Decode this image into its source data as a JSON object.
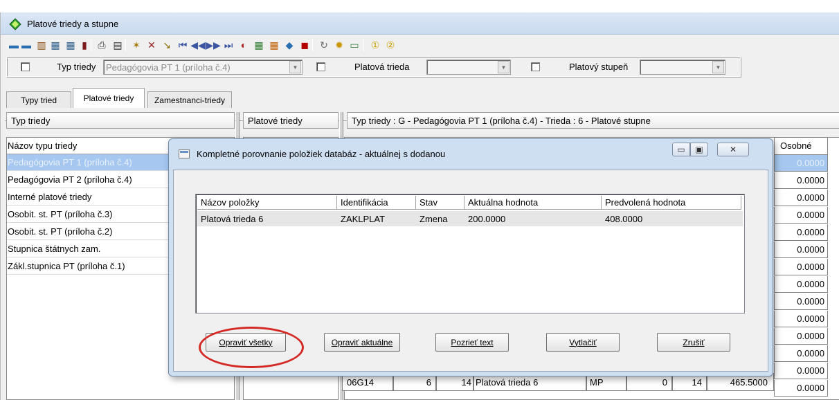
{
  "window": {
    "title": "Platové triedy a stupne"
  },
  "toolbar": {
    "icons": [
      "new-record-icon",
      "copy-record-icon",
      "columns-icon",
      "table-icon",
      "table-2-icon",
      "delete-icon",
      "print-icon",
      "print-preview-icon",
      "filter-icon",
      "clear-filter-icon",
      "sort-icon",
      "first-record-icon",
      "previous-record-icon",
      "next-record-icon",
      "last-record-icon",
      "refresh-icon",
      "calendar-icon",
      "import-icon",
      "export-icon",
      "copy-icon",
      "sync-icon",
      "lightbulb-icon",
      "window-icon",
      "info-1-icon",
      "info-2-icon"
    ],
    "glyphs": [
      "▬",
      "▬",
      "▥",
      "▦",
      "▦",
      "▮",
      "⎙",
      "▤",
      "✶",
      "✕",
      "↘",
      "⏮",
      "◀◀",
      "▶▶",
      "⏭",
      "◐",
      "▦",
      "▦",
      "◆",
      "◼",
      "↻",
      "✹",
      "▭",
      "①",
      "②"
    ]
  },
  "filters": {
    "typ_label": "Typ triedy",
    "typ_value": "Pedagógovia PT 1 (príloha č.4)",
    "trieda_label": "Platová trieda",
    "trieda_value": "",
    "stupen_label": "Platový stupeň",
    "stupen_value": ""
  },
  "tabs": [
    "Typy tried",
    "Platové triedy",
    "Zamestnanci-triedy"
  ],
  "panes": {
    "left_header": "Typ triedy",
    "middle_header": "Platové triedy",
    "right_header": "Typ triedy : G - Pedagógovia PT 1 (príloha č.4) - Trieda : 6 - Platové stupne",
    "list_header": "Názov typu triedy",
    "list_items": [
      "Pedagógovia PT 1 (príloha č.4)",
      "Pedagógovia PT 2 (príloha č.4)",
      "Interné platové triedy",
      "Osobit. st. PT (príloha č.3)",
      "Osobit. st. PT (príloha č.2)",
      "Stupnica štátnych zam.",
      "Zákl.stupnica PT (príloha č.1)"
    ],
    "osobne_header": "Osobné",
    "osobne_values": [
      "0.0000",
      "0.0000",
      "0.0000",
      "0.0000",
      "0.0000",
      "0.0000",
      "0.0000",
      "0.0000",
      "0.0000",
      "0.0000",
      "0.0000",
      "0.0000",
      "0.0000",
      "0.0000"
    ],
    "bottom_row": {
      "kod": "06G14",
      "trieda": "6",
      "stupen": "14",
      "nazov": "Platová trieda 6",
      "typ": "MP",
      "a": "0",
      "b": "14",
      "hodnota": "465.5000",
      "osobne": "0.0000"
    }
  },
  "dialog": {
    "title": "Kompletné porovnanie položiek databáz - aktuálnej s dodanou",
    "columns": [
      "Názov položky",
      "Identifikácia",
      "Stav",
      "Aktuálna hodnota",
      "Predvolená hodnota"
    ],
    "rows": [
      {
        "nazov": "Platová trieda 6",
        "id": "ZAKLPLAT",
        "stav": "Zmena",
        "aktualna": "200.0000",
        "predvolena": "408.0000"
      }
    ],
    "buttons": {
      "fix_all": "Opraviť všetky",
      "fix_current": "Opraviť aktuálne",
      "view_text": "Pozrieť text",
      "print": "Vytlačiť",
      "cancel": "Zrušiť"
    },
    "caption_glyphs": {
      "minimize": "▭",
      "maximize": "▣",
      "close": "✕"
    }
  },
  "colors": {
    "selection": "#a6c8f0",
    "highlight": "#d42a26",
    "dialog_frame": "#cfdff2"
  }
}
